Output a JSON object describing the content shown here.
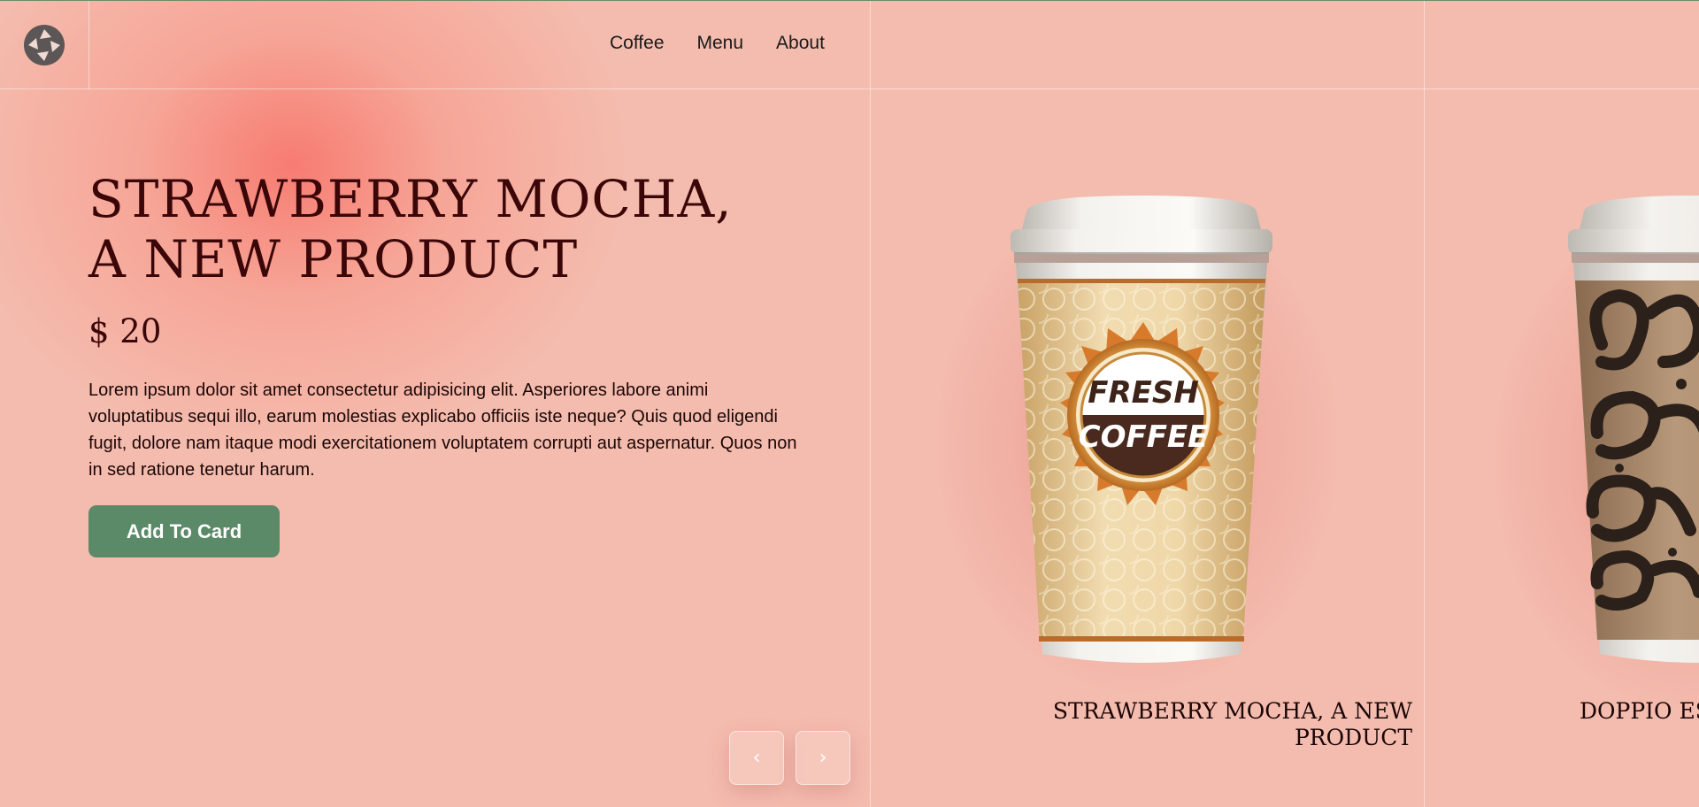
{
  "nav": {
    "links": [
      {
        "label": "Coffee"
      },
      {
        "label": "Menu"
      },
      {
        "label": "About"
      }
    ]
  },
  "hero": {
    "title": "STRAWBERRY MOCHA, A NEW PRODUCT",
    "price": "$ 20",
    "description": "Lorem ipsum dolor sit amet consectetur adipisicing elit. Asperiores labore animi voluptatibus sequi illo, earum molestias explicabo officiis iste neque? Quis quod eligendi fugit, dolore nam itaque modi exercitationem voluptatem corrupti aut aspernatur. Quos non in sed ratione tenetur harum.",
    "button_label": "Add To Card"
  },
  "slider": {
    "prev_symbol": "‹",
    "next_symbol": "›"
  },
  "products": [
    {
      "name_line1": "STRAWBERRY MOCHA, A NEW",
      "name_line2": "PRODUCT",
      "cup_badge_top": "FRESH",
      "cup_badge_bottom": "COFFEE"
    },
    {
      "name_line1": "DOPPIO ES",
      "name_line2": ""
    }
  ],
  "colors": {
    "background": "#f4bcae",
    "accent_glow": "#f7786e",
    "heading": "#3a0608",
    "button": "#5b8a68",
    "button_text": "#ffffff"
  },
  "icons": {
    "logo": "camera-shutter-logo-icon",
    "prev": "chevron-left-icon",
    "next": "chevron-right-icon"
  }
}
